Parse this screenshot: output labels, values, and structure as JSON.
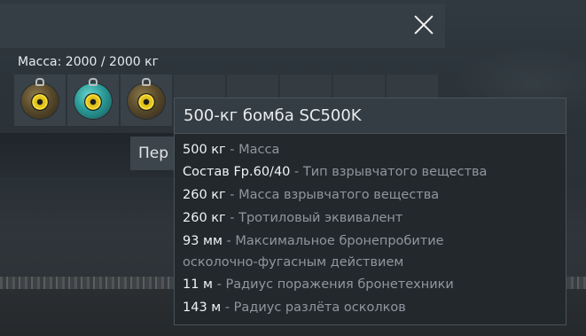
{
  "dialog": {
    "mass_label": "Масса: 2000 / 2000 кг",
    "partial_button_label": "Пер"
  },
  "slots": [
    {
      "icon": "bomb-icon",
      "selected": false
    },
    {
      "icon": "bomb-icon",
      "selected": true
    },
    {
      "icon": "bomb-icon",
      "selected": false
    }
  ],
  "tooltip": {
    "title": "500-кг бомба SC500K",
    "stats": [
      {
        "value": "500 кг",
        "desc": " - Масса"
      },
      {
        "value": "Состав Fp.60/40",
        "desc": " - Тип взрывчатого вещества"
      },
      {
        "value": "260 кг",
        "desc": " - Масса взрывчатого вещества"
      },
      {
        "value": "260 кг",
        "desc": " - Тротиловый эквивалент"
      },
      {
        "value": "93 мм",
        "desc": " - Максимальное бронепробитие",
        "desc2": "осколочно-фугасным действием"
      },
      {
        "value": "11 м",
        "desc": " - Радиус поражения бронетехники"
      },
      {
        "value": "143 м",
        "desc": " - Радиус разлёта осколков"
      }
    ]
  },
  "colors": {
    "selected_bomb": "#2b9b98",
    "bomb_fuze": "#e2c31a"
  }
}
